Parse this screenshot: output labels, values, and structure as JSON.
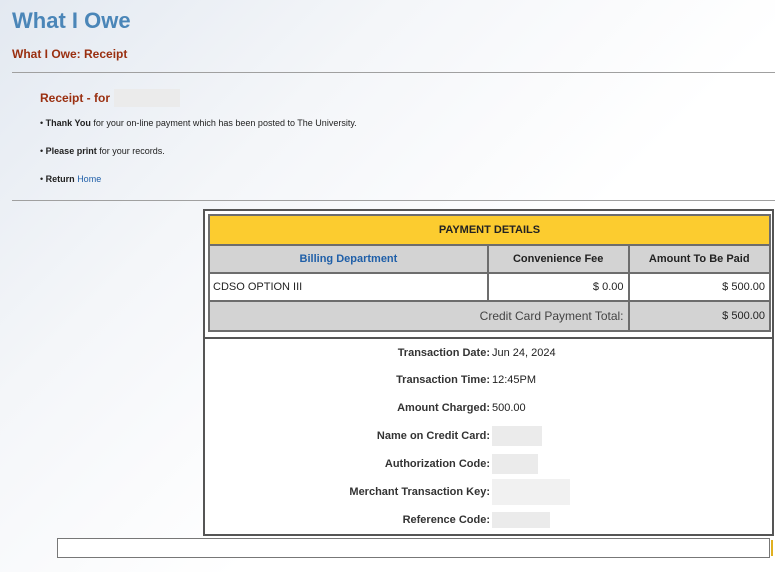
{
  "page": {
    "title": "What I Owe",
    "subtitle": "What I Owe: Receipt"
  },
  "receipt": {
    "heading": "Receipt - for",
    "bullets": [
      {
        "marker": "•",
        "bold": "Thank You",
        "text": " for your on-line payment which has been posted to The University."
      },
      {
        "marker": "•",
        "bold": "Please print",
        "text": " for your records."
      },
      {
        "marker": "•",
        "bold": "Return",
        "link": "Home"
      }
    ]
  },
  "payment": {
    "title": "PAYMENT DETAILS",
    "columns": [
      "Billing Department",
      "Convenience Fee",
      "Amount To Be Paid"
    ],
    "rows": [
      {
        "department": "CDSO OPTION III",
        "fee": "$ 0.00",
        "amount": "$ 500.00"
      }
    ],
    "total_label": "Credit Card Payment Total:",
    "total_value": "$ 500.00"
  },
  "transaction": [
    {
      "label": "Transaction Date:",
      "value": "Jun 24, 2024"
    },
    {
      "label": "Transaction Time:",
      "value": "12:45PM"
    },
    {
      "label": "Amount Charged:",
      "value": "500.00"
    },
    {
      "label": "Name on Credit Card:",
      "value": ""
    },
    {
      "label": "Authorization Code:",
      "value": ""
    },
    {
      "label": "Merchant Transaction Key:",
      "value": ""
    },
    {
      "label": "Reference Code:",
      "value": ""
    }
  ],
  "colors": {
    "title": "#4b86b8",
    "subtitle": "#9a2f10",
    "header_bg": "#fccc2f",
    "link": "#1f5fa8"
  }
}
